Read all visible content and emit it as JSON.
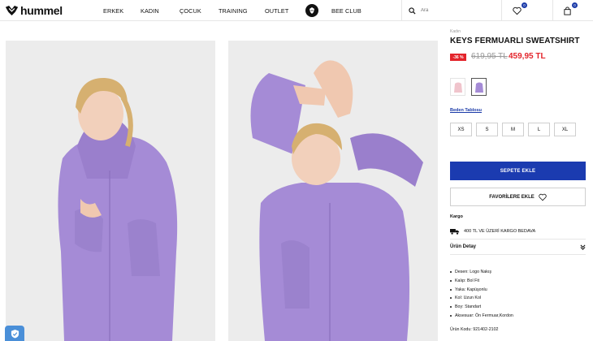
{
  "brand": {
    "name": "hummel"
  },
  "nav": {
    "items": [
      {
        "label": "ERKEK"
      },
      {
        "label": "KADIN"
      },
      {
        "label": "ÇOCUK"
      },
      {
        "label": "TRAINING"
      },
      {
        "label": "OUTLET"
      },
      {
        "label": "BEE CLUB"
      }
    ]
  },
  "search": {
    "placeholder": "Ara"
  },
  "header_icons": {
    "favorites_count": "0",
    "cart_count": "0"
  },
  "product": {
    "breadcrumb": "Kadın",
    "title": "KEYS FERMUARLI SWEATSHIRT",
    "discount": "-36 %",
    "old_price": "619,95 TL",
    "new_price": "459,95 TL",
    "size_chart_label": "Beden Tablosu",
    "sizes": [
      "XS",
      "S",
      "M",
      "L",
      "XL"
    ],
    "add_to_cart": "SEPETE EKLE",
    "add_to_favorites": "FAVORİLERE EKLE",
    "shipping_title": "Kargo",
    "shipping_text": "400 TL VE ÜZERİ KARGO BEDAVA",
    "details_title": "Ürün Detay",
    "details": [
      "Desen: Logo Nakış",
      "Kalıp: Bol Fit",
      "Yaka: Kapüşonlu",
      "Kol: Uzun Kol",
      "Boy: Standart",
      "Aksesuar: Ön Fermuar,Kordon"
    ],
    "product_code": "Ürün Kodu: 921402-2102"
  },
  "colors": {
    "accent": "#1b3bb0",
    "sale": "#e3242b",
    "product": "#a58bd6"
  }
}
